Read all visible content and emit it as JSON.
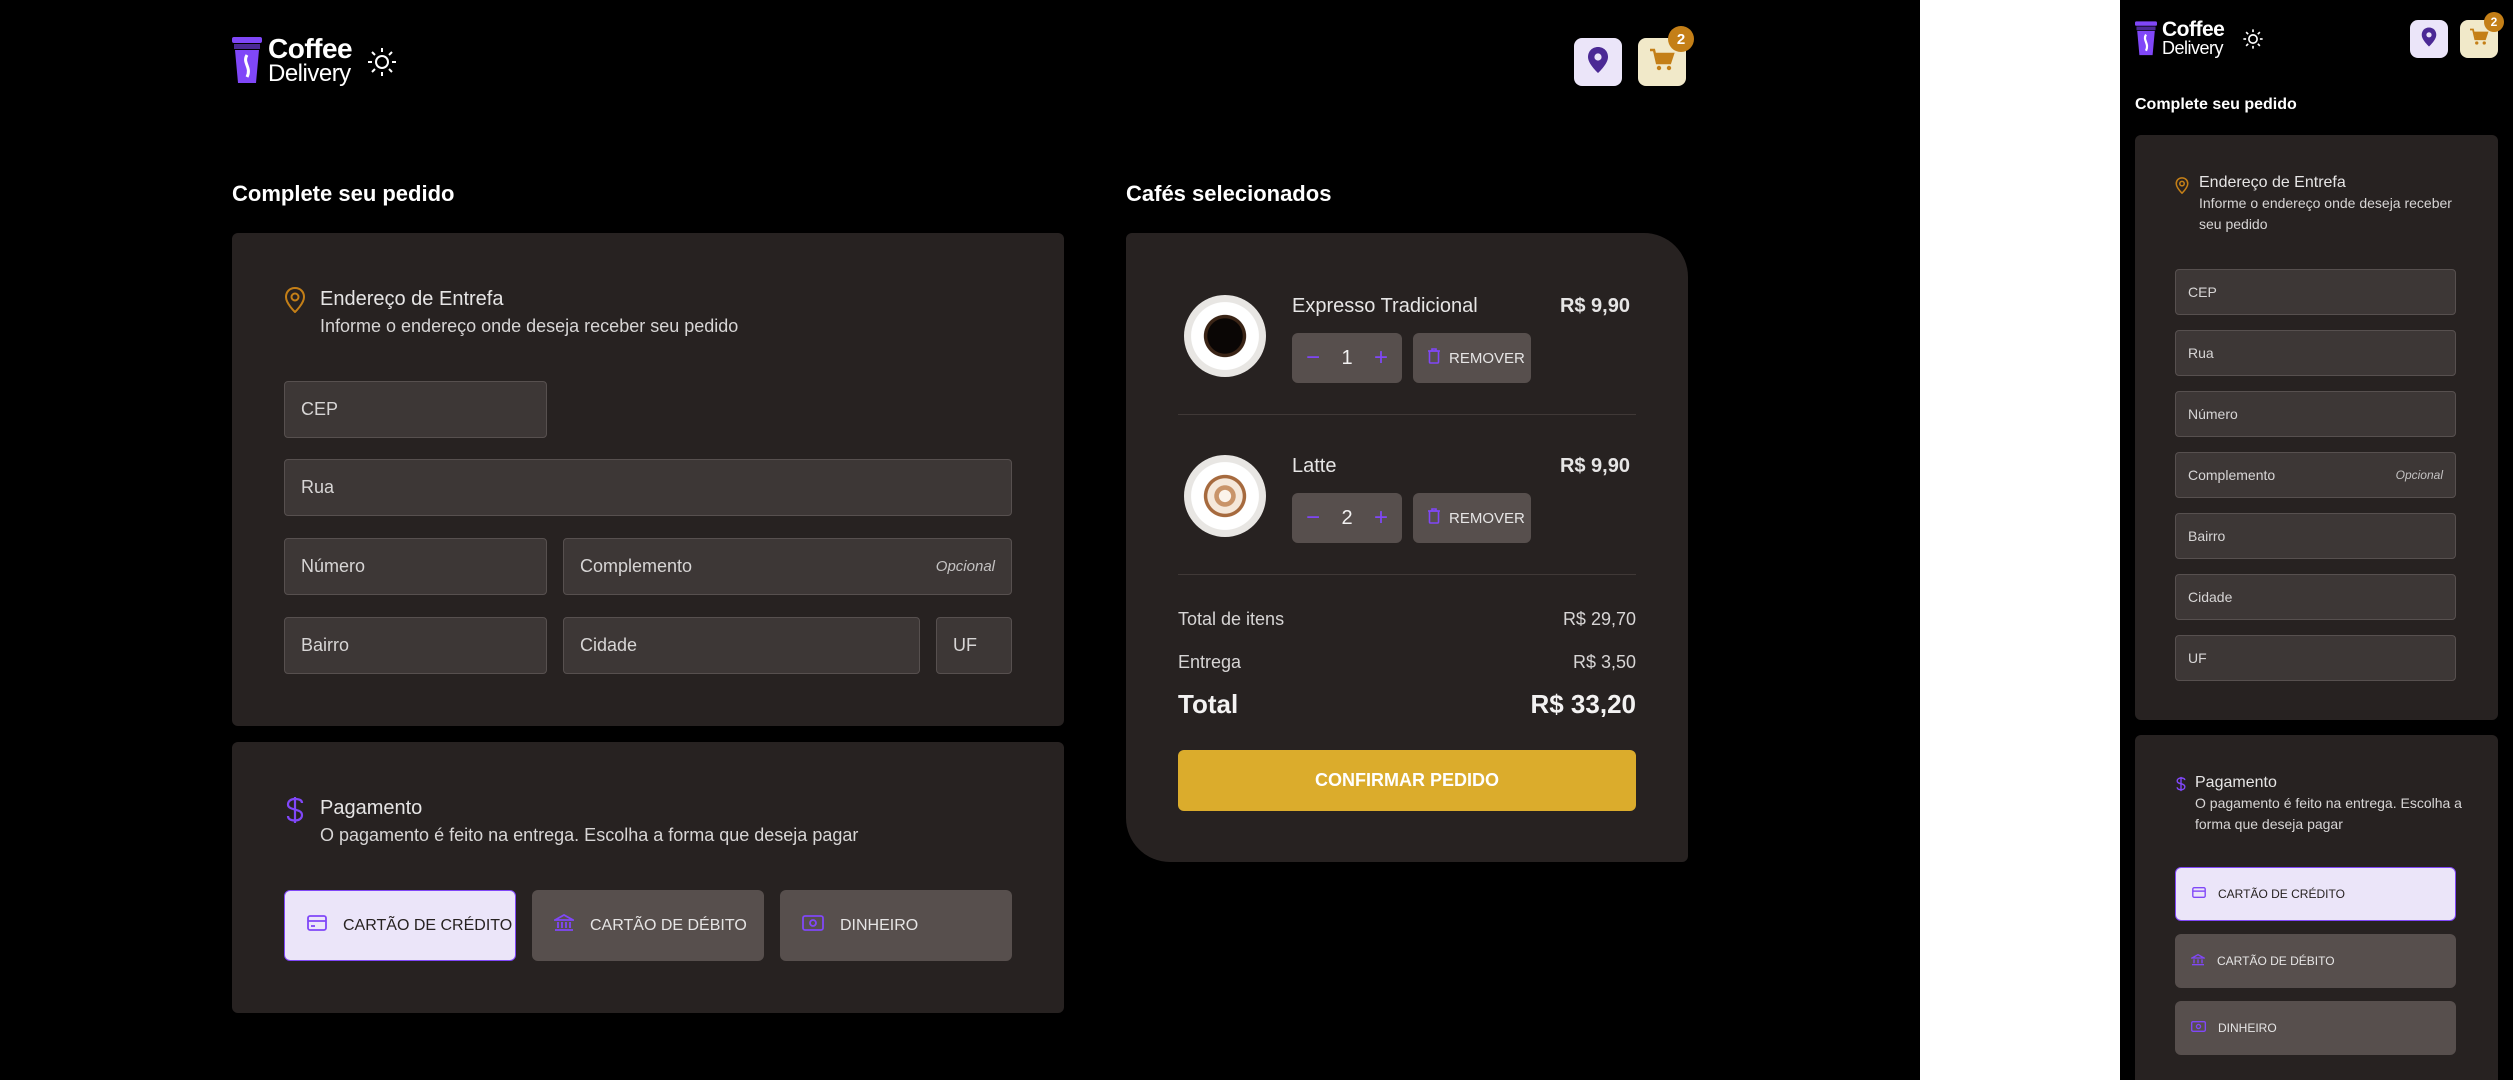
{
  "app": {
    "logo_line1": "Coffee",
    "logo_line2": "Delivery"
  },
  "colors": {
    "purple": "#8047f8",
    "yellow": "#dbac2c",
    "yellow_dark": "#c47f17",
    "card": "#272221",
    "input": "#3d3736"
  },
  "header": {
    "cart_count": "2"
  },
  "checkout": {
    "title": "Complete seu pedido",
    "address": {
      "heading": "Endereço de Entrefa",
      "subheading": "Informe o endereço onde deseja receber seu pedido",
      "fields": {
        "cep": "CEP",
        "rua": "Rua",
        "numero": "Número",
        "complemento": "Complemento",
        "opcional": "Opcional",
        "bairro": "Bairro",
        "cidade": "Cidade",
        "uf": "UF"
      }
    },
    "payment": {
      "heading": "Pagamento",
      "subheading": "O pagamento é feito na entrega. Escolha a forma que deseja pagar",
      "options": [
        {
          "label": "CARTÃO DE CRÉDITO",
          "icon": "credit-card-icon",
          "selected": true
        },
        {
          "label": "CARTÃO DE DÉBITO",
          "icon": "bank-icon",
          "selected": false
        },
        {
          "label": "DINHEIRO",
          "icon": "money-icon",
          "selected": false
        }
      ]
    }
  },
  "cart": {
    "title": "Cafés selecionados",
    "items": [
      {
        "name": "Expresso Tradicional",
        "price": "R$ 9,90",
        "qty": "1",
        "remove": "REMOVER"
      },
      {
        "name": "Latte",
        "price": "R$ 9,90",
        "qty": "2",
        "remove": "REMOVER"
      }
    ],
    "summary": {
      "items_label": "Total de itens",
      "items_value": "R$ 29,70",
      "delivery_label": "Entrega",
      "delivery_value": "R$ 3,50",
      "total_label": "Total",
      "total_value": "R$ 33,20"
    },
    "confirm": "CONFIRMAR PEDIDO"
  }
}
